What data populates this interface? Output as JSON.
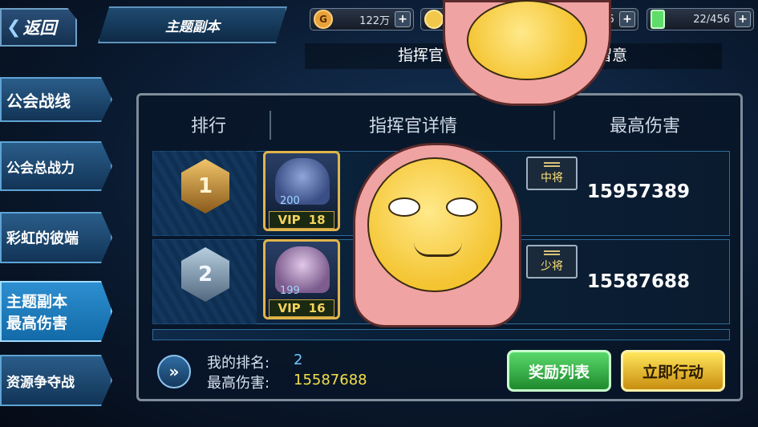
{
  "topbar": {
    "back_label": "返回",
    "title": "主题副本",
    "resources": [
      {
        "icon": "gold-coin-icon",
        "value": "122万",
        "color": "#e8a23a"
      },
      {
        "icon": "face-coin-icon",
        "value": "",
        "color": "#f1c84a"
      },
      {
        "icon": "crystal-icon",
        "value": "95",
        "color": "#6fc3ff"
      },
      {
        "icon": "energy-battery-icon",
        "value": "22/456",
        "color": "#5fdc6a"
      }
    ],
    "notice_left": "指挥官",
    "notice_right": "请留意"
  },
  "sidebar": {
    "items": [
      {
        "label": "公会战线",
        "active": false
      },
      {
        "label": "公会总战力",
        "active": false
      },
      {
        "label": "彩虹的彼端",
        "active": false
      },
      {
        "label": "主题副本",
        "label2": "最高伤害",
        "active": true
      },
      {
        "label": "资源争夺战",
        "active": false
      }
    ]
  },
  "table": {
    "headers": [
      "排行",
      "指挥官详情",
      "最高伤害"
    ],
    "rows": [
      {
        "rank": "1",
        "level": "200",
        "vip_label": "VIP",
        "vip_level": "18",
        "title": "中将",
        "damage": "15957389"
      },
      {
        "rank": "2",
        "level": "199",
        "vip_label": "VIP",
        "vip_level": "16",
        "title": "少将",
        "damage": "15587688"
      }
    ]
  },
  "footer": {
    "my_rank_label": "我的排名:",
    "my_rank_value": "2",
    "my_damage_label": "最高伤害:",
    "my_damage_value": "15587688",
    "reward_button": "奖励列表",
    "action_button": "立即行动"
  },
  "colors": {
    "accent_yellow": "#f5d35a",
    "rank_value_blue": "#6fc8ff",
    "damage_value_yellow": "#f2e04a"
  }
}
